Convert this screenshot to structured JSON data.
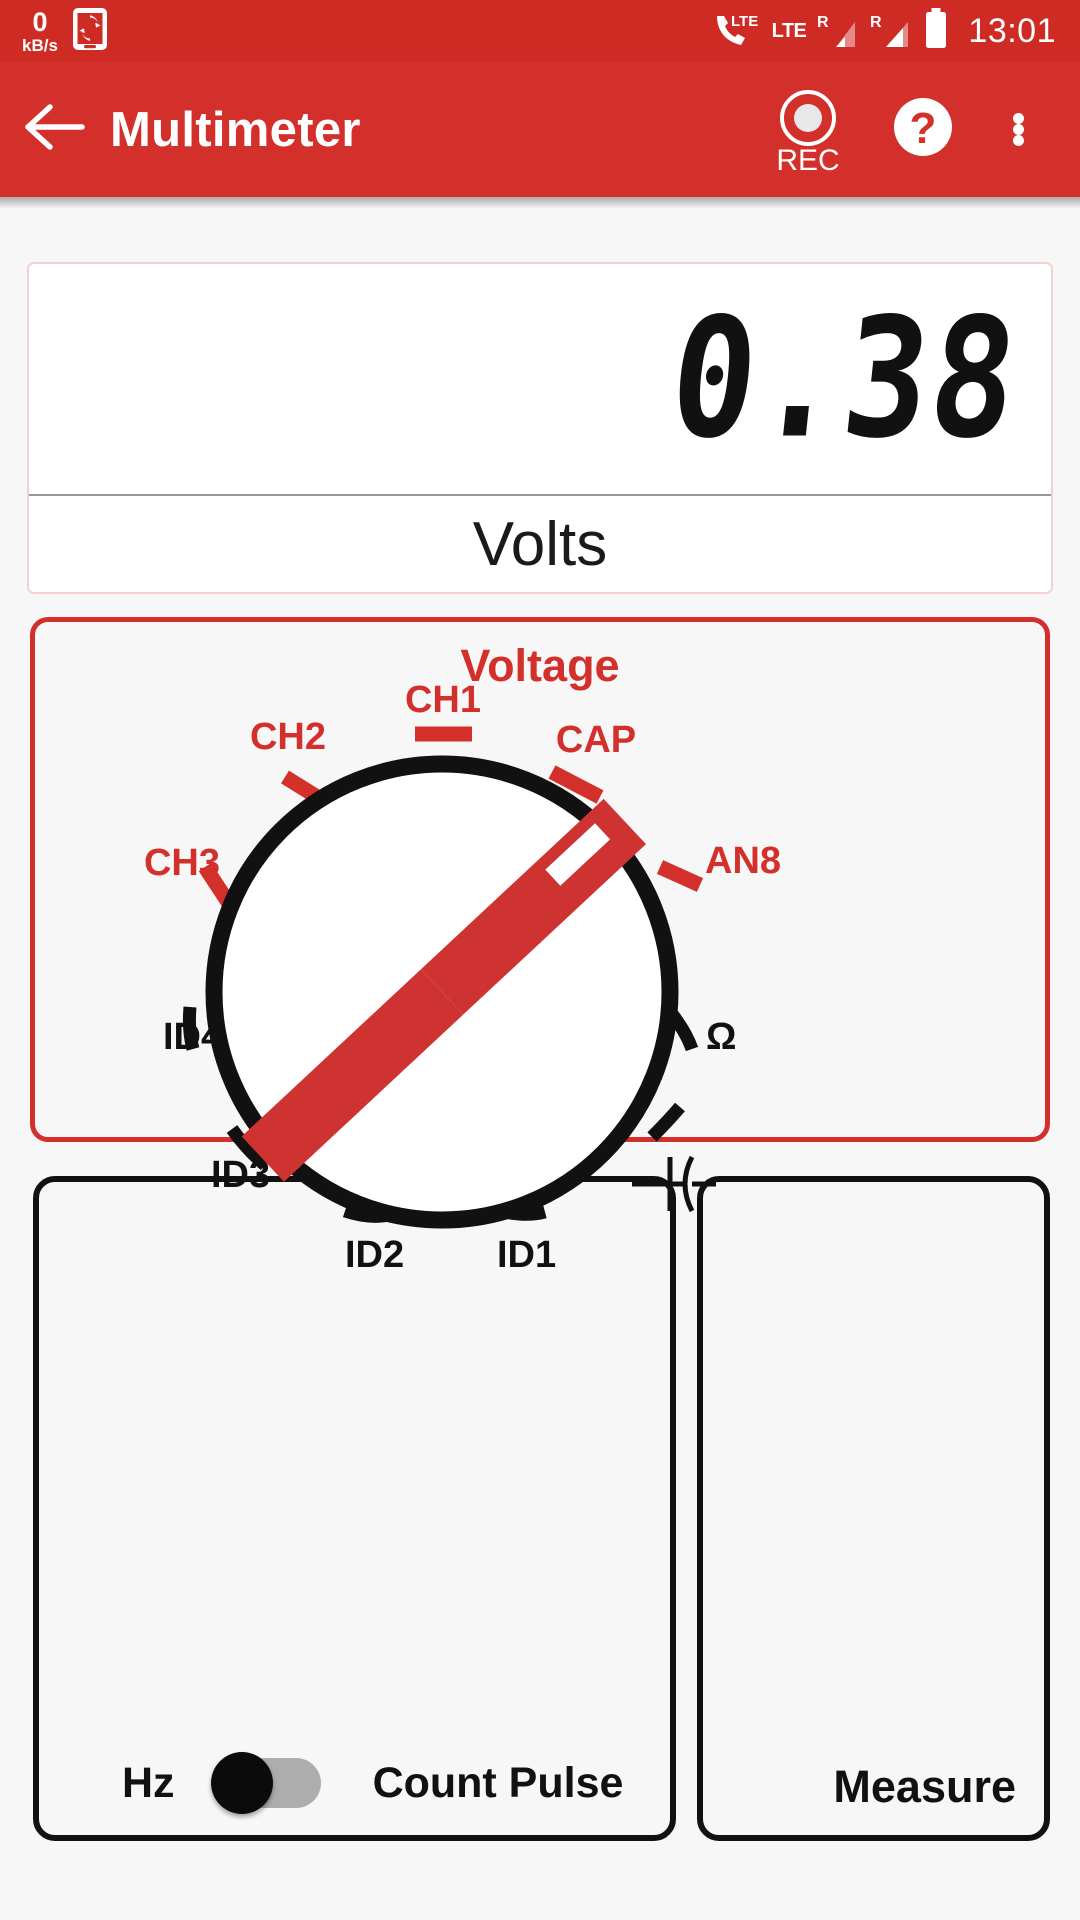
{
  "status_bar": {
    "net_speed_value": "0",
    "net_speed_unit": "kB/s",
    "sync_icon": "phone-sync-icon",
    "volte_icon": "call-lte-icon",
    "volte_label": "LTE",
    "sim1_label": "LTE",
    "sim1_roaming": "R",
    "sim2_roaming": "R",
    "battery_icon": "battery-full-icon",
    "clock": "13:01"
  },
  "app_bar": {
    "back_icon": "back-arrow-icon",
    "title": "Multimeter",
    "rec_label": "REC",
    "rec_icon": "record-circle-icon",
    "help_icon": "help-question-icon",
    "overflow_icon": "more-vertical-icon"
  },
  "display": {
    "value": "0.38",
    "unit": "Volts"
  },
  "voltage_panel": {
    "title": "Voltage",
    "title_color": "#d32f2b",
    "border_color": "#d32f2b"
  },
  "count_panel": {
    "hz_label": "Hz",
    "count_label": "Count Pulse",
    "toggle_state": "off",
    "toggle_thumb_color": "#0b0b0b",
    "toggle_track_color": "#adadad"
  },
  "measure_panel": {
    "label": "Measure"
  },
  "dial": {
    "selected": "CAP",
    "pointer_color": "#cf3331",
    "ring_color": "#111111",
    "upper_color": "#d32f2b",
    "lower_color": "#111111",
    "positions": [
      {
        "label": "CH3",
        "group": "voltage",
        "angle": -125
      },
      {
        "label": "CH2",
        "group": "voltage",
        "angle": -97
      },
      {
        "label": "CH1",
        "group": "voltage",
        "angle": -70
      },
      {
        "label": "CAP",
        "group": "voltage",
        "angle": -42
      },
      {
        "label": "AN8",
        "group": "voltage",
        "angle": -14
      },
      {
        "label": "Ω",
        "group": "measure",
        "angle": 14
      },
      {
        "label": "cap-symbol",
        "group": "measure",
        "angle": 42
      },
      {
        "label": "ID1",
        "group": "count",
        "angle": 70
      },
      {
        "label": "ID2",
        "group": "count",
        "angle": 97
      },
      {
        "label": "ID3",
        "group": "count",
        "angle": 125
      },
      {
        "label": "ID4",
        "group": "count",
        "angle": 152
      }
    ],
    "labels": {
      "ch1": "CH1",
      "ch2": "CH2",
      "ch3": "CH3",
      "cap": "CAP",
      "an8": "AN8",
      "ohm": "Ω",
      "id1": "ID1",
      "id2": "ID2",
      "id3": "ID3",
      "id4": "ID4"
    }
  }
}
